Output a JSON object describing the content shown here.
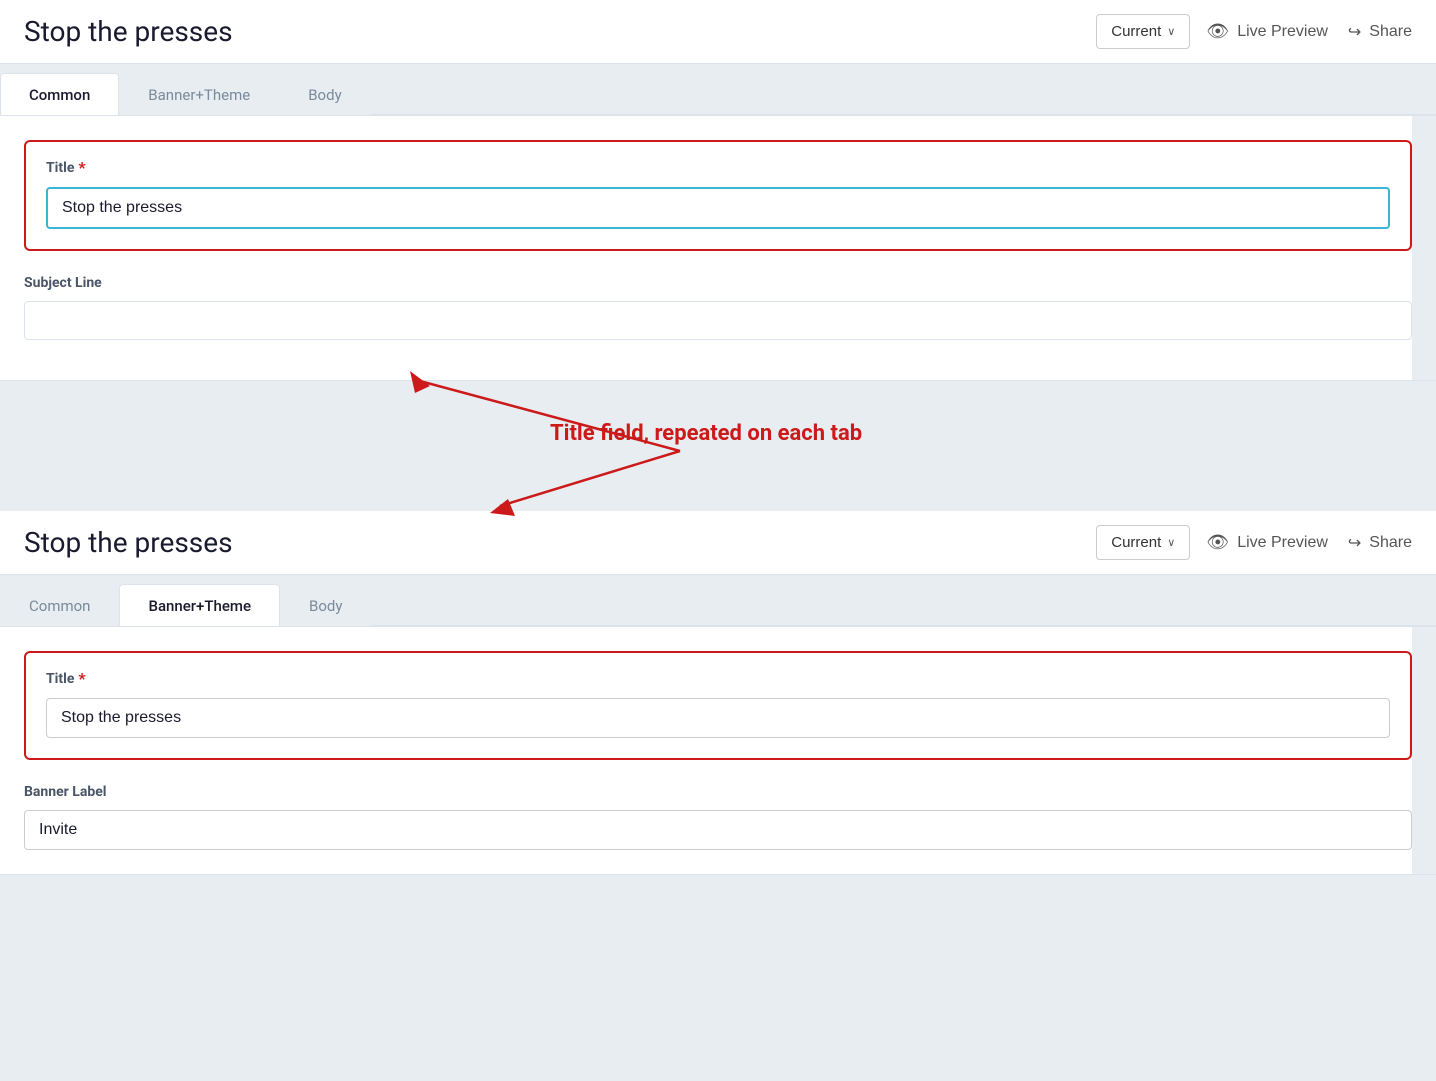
{
  "page": {
    "title": "Stop the presses",
    "current_btn": "Current",
    "chevron": "∨",
    "live_preview_label": "Live Preview",
    "share_label": "Share"
  },
  "tabs": {
    "panel1": [
      {
        "id": "common",
        "label": "Common",
        "active": true
      },
      {
        "id": "banner-theme",
        "label": "Banner+Theme",
        "active": false
      },
      {
        "id": "body",
        "label": "Body",
        "active": false
      }
    ],
    "panel2": [
      {
        "id": "common2",
        "label": "Common",
        "active": false
      },
      {
        "id": "banner-theme2",
        "label": "Banner+Theme",
        "active": true
      },
      {
        "id": "body2",
        "label": "Body",
        "active": false
      }
    ]
  },
  "fields": {
    "title_label": "Title",
    "title_value": "Stop the presses",
    "subject_line_label": "Subject Line",
    "subject_line_value": "",
    "subject_line_placeholder": "",
    "banner_label_label": "Banner Label",
    "banner_label_value": "Invite"
  },
  "annotation": {
    "text": "Title field, repeated on each tab"
  },
  "icons": {
    "eye": "👁",
    "share": "↪"
  }
}
